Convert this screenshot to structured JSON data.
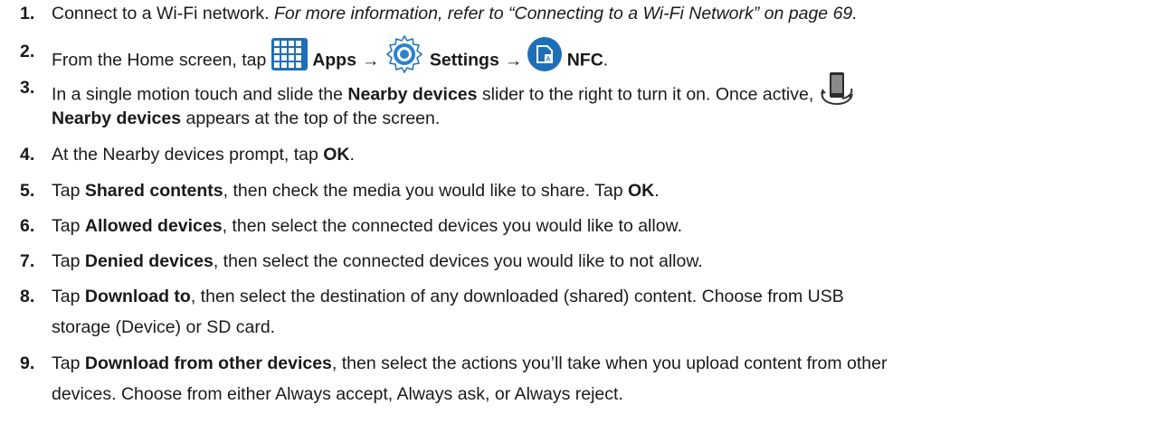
{
  "steps": [
    {
      "num": "1.",
      "t1": "Connect to a Wi-Fi network. ",
      "ref": "For more information, refer to “Connecting to a Wi-Fi Network” on page 69."
    },
    {
      "num": "2.",
      "t1": "From the Home screen, tap ",
      "b1": "Apps",
      "arrow1": "→",
      "b2": "Settings",
      "arrow2": "→",
      "b3": "NFC",
      "t2": "."
    },
    {
      "num": "3.",
      "t1": "In a single motion touch and slide the ",
      "b1": "Nearby devices",
      "t2": " slider to the right to turn it on. Once active, ",
      "b2": "Nearby devices",
      "t3": " appears at the top of the screen."
    },
    {
      "num": "4.",
      "t1": "At the Nearby devices prompt, tap ",
      "b1": "OK",
      "t2": "."
    },
    {
      "num": "5.",
      "t1": "Tap ",
      "b1": "Shared contents",
      "t2": ", then check the media you would like to share. Tap ",
      "b2": "OK",
      "t3": "."
    },
    {
      "num": "6.",
      "t1": "Tap ",
      "b1": "Allowed devices",
      "t2": ", then select the connected devices you would like to allow."
    },
    {
      "num": "7.",
      "t1": "Tap ",
      "b1": "Denied devices",
      "t2": ", then select the connected devices you would like to not allow."
    },
    {
      "num": "8.",
      "t1": "Tap ",
      "b1": "Download to",
      "t2": ", then select the destination of any downloaded (shared) content. Choose from USB",
      "t3": "storage (Device) or SD card."
    },
    {
      "num": "9.",
      "t1": "Tap ",
      "b1": "Download from other devices",
      "t2": ", then select the actions you’ll take when you upload content from other",
      "t3": "devices. Choose from either Always accept, Always ask, or Always reject."
    }
  ],
  "colors": {
    "accent_blue": "#1e6fb8",
    "text": "#1a1a1a"
  },
  "icons": [
    "apps-grid-icon",
    "settings-gear-icon",
    "nfc-icon",
    "nearby-devices-icon"
  ]
}
